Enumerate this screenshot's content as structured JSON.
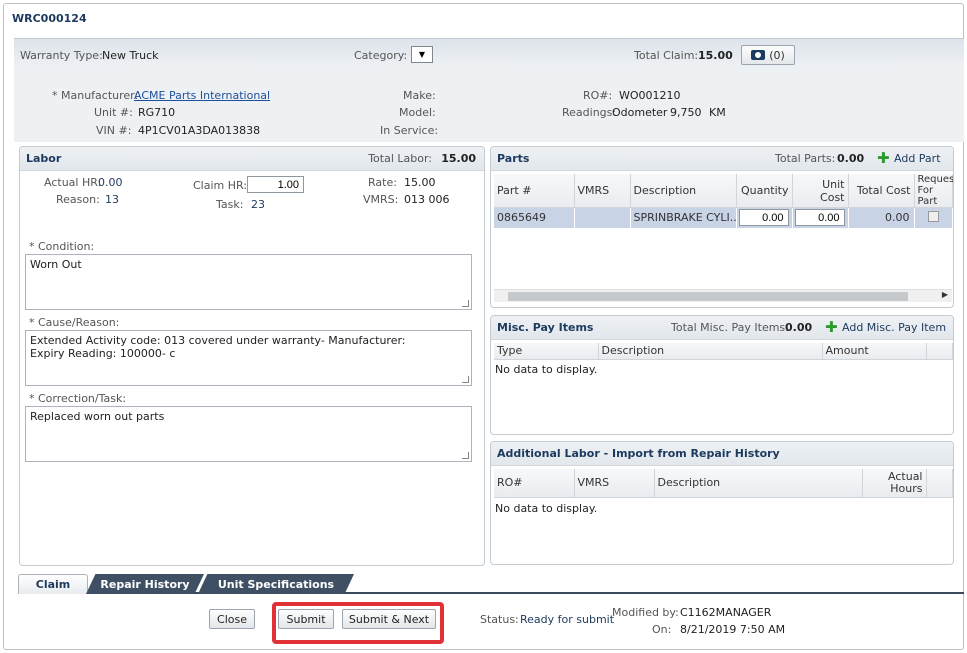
{
  "title": "WRC000124",
  "header": {
    "warranty_type_label": "Warranty Type:",
    "warranty_type_value": "New Truck",
    "category_label": "Category:",
    "total_claim_label": "Total Claim:",
    "total_claim_value": "15.00",
    "attachment_count": "(0)",
    "manufacturer_label": "* Manufacturer:",
    "manufacturer_value": "ACME Parts International",
    "unit_label": "Unit #:",
    "unit_value": "RG710",
    "vin_label": "VIN #:",
    "vin_value": "4P1CV01A3DA013838",
    "make_label": "Make:",
    "model_label": "Model:",
    "in_service_label": "In Service:",
    "ro_label": "RO#:",
    "ro_value": "WO001210",
    "readings_label": "Readings:",
    "readings_type": "Odometer",
    "readings_value": "9,750",
    "readings_unit": "KM"
  },
  "labor": {
    "title": "Labor",
    "total_label": "Total Labor:",
    "total_value": "15.00",
    "actual_hr_label": "Actual HR:",
    "actual_hr_value": "0.00",
    "reason_label": "Reason:",
    "reason_value": "13",
    "claim_hr_label": "Claim HR:",
    "claim_hr_value": "1.00",
    "task_label": "Task:",
    "task_value": "23",
    "rate_label": "Rate:",
    "rate_value": "15.00",
    "vmrs_label": "VMRS:",
    "vmrs_value": "013 006",
    "condition_label": "* Condition:",
    "condition_value": "Worn Out",
    "cause_label": "* Cause/Reason:",
    "cause_line1": "Extended Activity code: 013  covered under warranty- Manufacturer:",
    "cause_line2": "Expiry Reading: 100000- c",
    "correction_label": "* Correction/Task:",
    "correction_value": "Replaced worn out parts"
  },
  "parts": {
    "title": "Parts",
    "total_label": "Total Parts:",
    "total_value": "0.00",
    "add_label": "Add Part",
    "columns": [
      "Part #",
      "VMRS",
      "Description",
      "Quantity",
      "Unit Cost",
      "Total Cost",
      "Request For Part"
    ],
    "row": {
      "part": "0865649",
      "vmrs": "",
      "description": "SPRINBRAKE CYLI...",
      "quantity": "0.00",
      "unit_cost": "0.00",
      "total_cost": "0.00"
    }
  },
  "misc": {
    "title": "Misc. Pay Items",
    "total_label": "Total Misc. Pay Items:",
    "total_value": "0.00",
    "add_label": "Add Misc. Pay Item",
    "columns": [
      "Type",
      "Description",
      "Amount"
    ],
    "empty": "No data to display."
  },
  "additional": {
    "title": "Additional Labor - Import from Repair History",
    "columns": [
      "RO#",
      "VMRS",
      "Description",
      "Actual Hours"
    ],
    "empty": "No data to display."
  },
  "tabs": [
    "Claim",
    "Repair History",
    "Unit Specifications"
  ],
  "footer": {
    "close": "Close",
    "submit": "Submit",
    "submit_next": "Submit & Next",
    "status_label": "Status:",
    "status_value": "Ready for submit",
    "modified_by_label": "Modified by:",
    "modified_by_value": "C1162MANAGER",
    "on_label": "On:",
    "on_value": "8/21/2019 7:50 AM"
  },
  "colors": {
    "highlight": "#e03236",
    "accent": "#1c3a5e",
    "add_icon": "#2e9a2e"
  }
}
